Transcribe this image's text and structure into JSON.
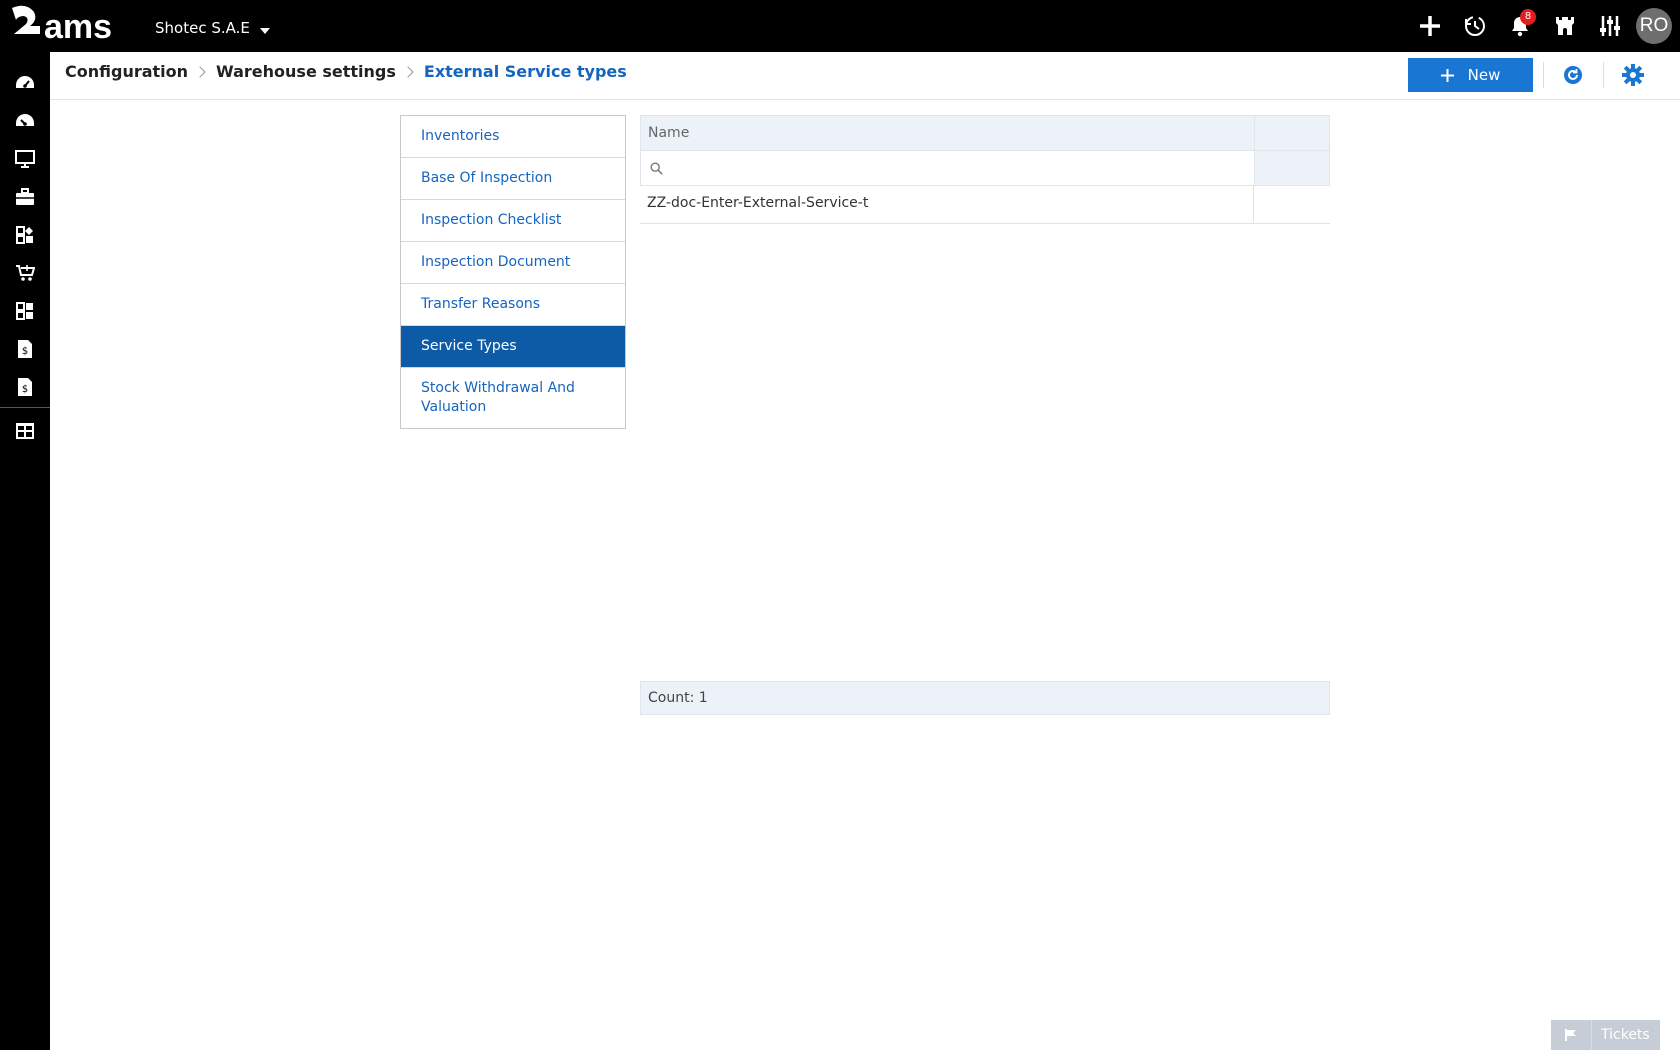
{
  "app": {
    "logo_text": "ams",
    "company": "Shotec S.A.E",
    "notifications_count": "8",
    "user_initials": "RO"
  },
  "top_icons": [
    "plus-icon",
    "history-icon",
    "bell-icon",
    "castle-icon",
    "sliders-icon"
  ],
  "rail": {
    "items": [
      "dashboard-icon",
      "dashboard-alt-icon",
      "monitor-icon",
      "briefcase-icon",
      "modules-icon",
      "cart-icon",
      "modules-alt-icon",
      "invoice-icon",
      "invoice-alt-icon",
      "layout-icon"
    ]
  },
  "breadcrumb": {
    "items": [
      "Configuration",
      "Warehouse settings"
    ],
    "current": "External Service types"
  },
  "header": {
    "new_label": "New"
  },
  "side_menu": {
    "items": [
      {
        "label": "Inventories",
        "active": false
      },
      {
        "label": "Base Of Inspection",
        "active": false
      },
      {
        "label": "Inspection Checklist",
        "active": false
      },
      {
        "label": "Inspection Document",
        "active": false
      },
      {
        "label": "Transfer Reasons",
        "active": false
      },
      {
        "label": "Service Types",
        "active": true
      },
      {
        "label": "Stock Withdrawal And Valuation",
        "active": false
      }
    ]
  },
  "grid": {
    "columns": [
      "Name",
      ""
    ],
    "filter_value": "",
    "rows": [
      {
        "name": "ZZ-doc-Enter-External-Service-t"
      }
    ],
    "footer": "Count: 1"
  },
  "tickets": {
    "label": "Tickets"
  },
  "colors": {
    "accent": "#1976d2",
    "active_menu": "#0d5aa7",
    "link": "#1565c0",
    "grid_header": "#edf2f8"
  }
}
